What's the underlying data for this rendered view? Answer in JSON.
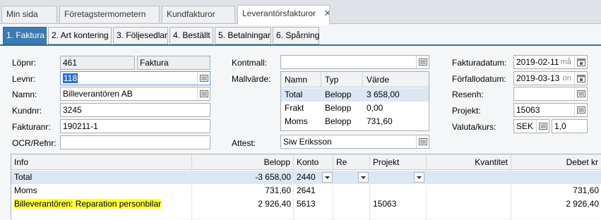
{
  "doc_tabs": [
    "Min sida",
    "Företagstermometern",
    "Kundfakturor",
    "Leverantörsfakturor"
  ],
  "active_doc_tab_close": "✕",
  "sub_tabs": [
    "1. Faktura",
    "2. Art kontering",
    "3. Följesedlar",
    "4. Beställt",
    "5. Betalningar",
    "6. Spårning"
  ],
  "form": {
    "lopnr_label": "Löpnr:",
    "lopnr": "461",
    "lopnr_type": "Faktura",
    "levnr_label": "Levnr:",
    "levnr": "118",
    "namn_label": "Namn:",
    "namn": "Billeverantören AB",
    "kundnr_label": "Kundnr:",
    "kundnr": "3245",
    "fakturanr_label": "Fakturanr:",
    "fakturanr": "190211-1",
    "ocr_label": "OCR/Refnr:",
    "ocr": "",
    "kontmall_label": "Kontmall:",
    "kontmall": "",
    "mallvarde_label": "Mallvärde:",
    "attest_label": "Attest:",
    "attest": "Siw Eriksson",
    "fakturadatum_label": "Fakturadatum:",
    "fakturadatum": "2019-02-11",
    "fakturadatum_day": "må",
    "forfallodatum_label": "Förfallodatum:",
    "forfallodatum": "2019-03-13",
    "forfallodatum_day": "on",
    "resenh_label": "Resenh:",
    "resenh": "",
    "projekt_label": "Projekt:",
    "projekt": "15063",
    "valuta_label": "Valuta/kurs:",
    "valuta": "SEK",
    "kurs": "1,0"
  },
  "mall_grid": {
    "headers": [
      "Namn",
      "Typ",
      "Värde"
    ],
    "rows": [
      [
        "Total",
        "Belopp",
        "3 658,00"
      ],
      [
        "Frakt",
        "Belopp",
        "0,00"
      ],
      [
        "Moms",
        "Belopp",
        "731,60"
      ]
    ]
  },
  "main_grid": {
    "headers": [
      "Info",
      "Belopp",
      "Konto",
      "Re",
      "Projekt",
      "Kvantitet",
      "Debet kr"
    ],
    "rows": [
      [
        "Total",
        "-3 658,00",
        "2440",
        "",
        "",
        "",
        ""
      ],
      [
        "Moms",
        "731,60",
        "2641",
        "",
        "",
        "",
        "731,60"
      ],
      [
        "Billeverantören: Reparation personbilar",
        "2 926,40",
        "5613",
        "",
        "15063",
        "",
        "2 926,40"
      ]
    ]
  },
  "colors": {
    "accent": "#3d7ab3",
    "highlight": "#ffff33",
    "selected_row": "#dce7f4"
  },
  "icons": [
    "close-icon",
    "lookup-icon",
    "calendar-icon",
    "chevron-down-icon"
  ]
}
